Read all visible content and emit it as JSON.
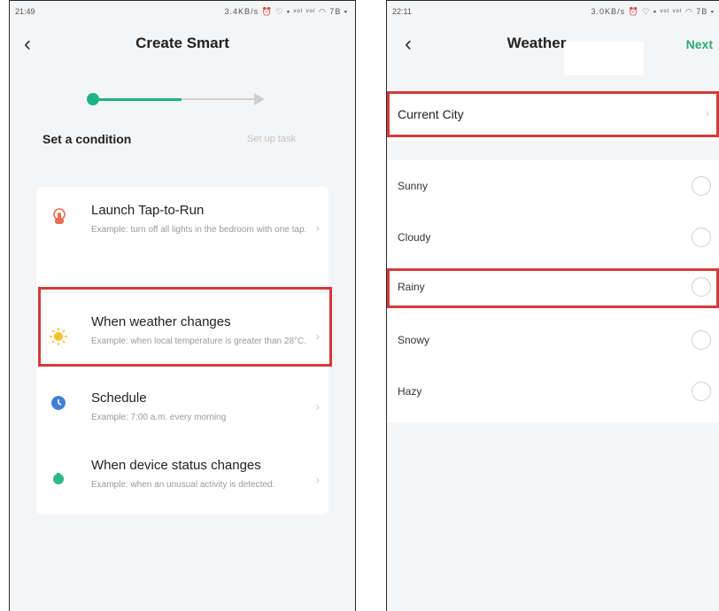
{
  "left_screen": {
    "status": {
      "time": "21:49",
      "icons": "3.4KB/s ⏰ ♡ ▪ ᵛᵒˡ ᵛᵒˡ ◠ 7B ▪"
    },
    "header": {
      "title": "Create Smart"
    },
    "stepper": {
      "active_label": "Set a condition",
      "inactive_label": "Set up task"
    },
    "options": [
      {
        "title": "Launch Tap-to-Run",
        "description": "Example: turn off all lights in the bedroom with one tap.",
        "icon": "tap-hand-icon",
        "icon_color": "#ea6d55"
      },
      {
        "title": "When weather changes",
        "description": "Example: when local temperature is greater than 28°C.",
        "icon": "sun-icon",
        "icon_color": "#f2c428"
      },
      {
        "title": "Schedule",
        "description": "Example: 7:00 a.m. every morning",
        "icon": "clock-icon",
        "icon_color": "#3f7fd6"
      },
      {
        "title": "When device status changes",
        "description": "Example: when an unusual activity is detected.",
        "icon": "device-icon",
        "icon_color": "#2eb88a"
      }
    ]
  },
  "right_screen": {
    "status": {
      "time": "22:11",
      "icons": "3.0KB/s ⏰ ♡ ▪ ᵛᵒˡ ᵛᵒˡ ◠ 7B ▪"
    },
    "header": {
      "title": "Weather",
      "next_label": "Next"
    },
    "city": {
      "label": "Current City"
    },
    "conditions": [
      {
        "label": "Sunny"
      },
      {
        "label": "Cloudy"
      },
      {
        "label": "Rainy"
      },
      {
        "label": "Snowy"
      },
      {
        "label": "Hazy"
      }
    ]
  },
  "colors": {
    "accent": "#1db388",
    "highlight": "#d53a3a",
    "next": "#2aab78"
  }
}
